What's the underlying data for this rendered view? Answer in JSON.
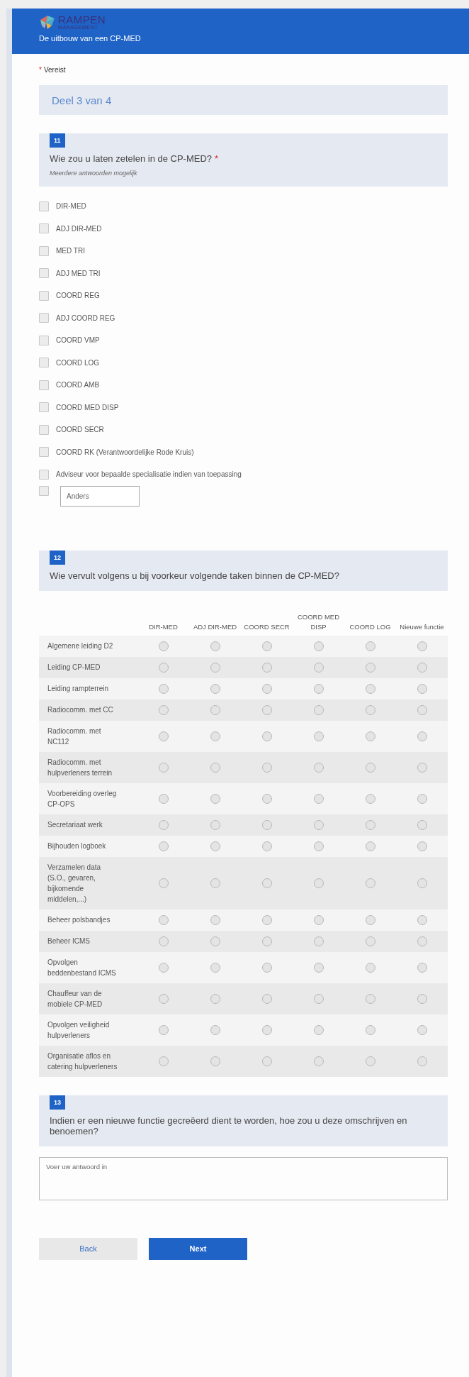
{
  "header": {
    "logo_name": "RAMPEN",
    "logo_tagline": "MANAGEMENT",
    "title": "De uitbouw van een CP-MED"
  },
  "required_note": {
    "mark": "*",
    "text": "Vereist"
  },
  "section": "Deel 3 van 4",
  "questions": [
    {
      "kind": "checkboxes",
      "number": "11",
      "title": "Wie zou u laten zetelen in de CP-MED?",
      "required": true,
      "hint": "Meerdere antwoorden mogelijk",
      "options": [
        {
          "label": "DIR-MED",
          "checked": false
        },
        {
          "label": "ADJ DIR-MED",
          "checked": false
        },
        {
          "label": "MED TRI",
          "checked": false
        },
        {
          "label": "ADJ MED TRI",
          "checked": false
        },
        {
          "label": "COORD REG",
          "checked": false
        },
        {
          "label": "ADJ COORD REG",
          "checked": false
        },
        {
          "label": "COORD VMP",
          "checked": false
        },
        {
          "label": "COORD LOG",
          "checked": false
        },
        {
          "label": "COORD AMB",
          "checked": false
        },
        {
          "label": "COORD MED DISP",
          "checked": false
        },
        {
          "label": "COORD SECR",
          "checked": false
        },
        {
          "label": "COORD RK (Verantwoordelijke Rode Kruis)",
          "checked": false
        },
        {
          "label": "Adviseur voor bepaalde specialisatie indien van toepassing",
          "checked": false
        }
      ],
      "other": {
        "checked": false,
        "placeholder": "Anders"
      }
    },
    {
      "kind": "matrix",
      "number": "12",
      "title": "Wie vervult volgens u bij voorkeur volgende taken binnen de CP-MED?",
      "required": false,
      "columns": [
        "DIR-MED",
        "ADJ DIR-MED",
        "COORD SECR",
        "COORD MED DISP",
        "COORD LOG",
        "Nieuwe functie"
      ],
      "rows": [
        {
          "label": "Algemene leiding D2",
          "cells": [
            {
              "selected": false
            },
            {
              "selected": false
            },
            {
              "selected": false
            },
            {
              "selected": false
            },
            {
              "selected": false
            },
            {
              "selected": false
            }
          ]
        },
        {
          "label": "Leiding CP-MED",
          "cells": [
            {
              "selected": false
            },
            {
              "selected": false
            },
            {
              "selected": false
            },
            {
              "selected": false
            },
            {
              "selected": false
            },
            {
              "selected": false
            }
          ]
        },
        {
          "label": "Leiding rampterrein",
          "cells": [
            {
              "selected": false
            },
            {
              "selected": false
            },
            {
              "selected": false
            },
            {
              "selected": false
            },
            {
              "selected": false
            },
            {
              "selected": false
            }
          ]
        },
        {
          "label": "Radiocomm. met CC",
          "cells": [
            {
              "selected": false
            },
            {
              "selected": false
            },
            {
              "selected": false
            },
            {
              "selected": false
            },
            {
              "selected": false
            },
            {
              "selected": false
            }
          ]
        },
        {
          "label": "Radiocomm. met NC112",
          "cells": [
            {
              "selected": false
            },
            {
              "selected": false
            },
            {
              "selected": false
            },
            {
              "selected": false
            },
            {
              "selected": false
            },
            {
              "selected": false
            }
          ]
        },
        {
          "label": "Radiocomm. met hulpverleners terrein",
          "cells": [
            {
              "selected": false
            },
            {
              "selected": false
            },
            {
              "selected": false
            },
            {
              "selected": false
            },
            {
              "selected": false
            },
            {
              "selected": false
            }
          ]
        },
        {
          "label": "Voorbereiding overleg CP-OPS",
          "cells": [
            {
              "selected": false
            },
            {
              "selected": false
            },
            {
              "selected": false
            },
            {
              "selected": false
            },
            {
              "selected": false
            },
            {
              "selected": false
            }
          ]
        },
        {
          "label": "Secretariaat werk",
          "cells": [
            {
              "selected": false
            },
            {
              "selected": false
            },
            {
              "selected": false
            },
            {
              "selected": false
            },
            {
              "selected": false
            },
            {
              "selected": false
            }
          ]
        },
        {
          "label": "Bijhouden logboek",
          "cells": [
            {
              "selected": false
            },
            {
              "selected": false
            },
            {
              "selected": false
            },
            {
              "selected": false
            },
            {
              "selected": false
            },
            {
              "selected": false
            }
          ]
        },
        {
          "label": "Verzamelen data (S.O., gevaren, bijkomende middelen,...)",
          "cells": [
            {
              "selected": false
            },
            {
              "selected": false
            },
            {
              "selected": false
            },
            {
              "selected": false
            },
            {
              "selected": false
            },
            {
              "selected": false
            }
          ]
        },
        {
          "label": "Beheer polsbandjes",
          "cells": [
            {
              "selected": false
            },
            {
              "selected": false
            },
            {
              "selected": false
            },
            {
              "selected": false
            },
            {
              "selected": false
            },
            {
              "selected": false
            }
          ]
        },
        {
          "label": "Beheer ICMS",
          "cells": [
            {
              "selected": false
            },
            {
              "selected": false
            },
            {
              "selected": false
            },
            {
              "selected": false
            },
            {
              "selected": false
            },
            {
              "selected": false
            }
          ]
        },
        {
          "label": "Opvolgen beddenbestand ICMS",
          "cells": [
            {
              "selected": false
            },
            {
              "selected": false
            },
            {
              "selected": false
            },
            {
              "selected": false
            },
            {
              "selected": false
            },
            {
              "selected": false
            }
          ]
        },
        {
          "label": "Chauffeur van de mobiele CP-MED",
          "cells": [
            {
              "selected": false
            },
            {
              "selected": false
            },
            {
              "selected": false
            },
            {
              "selected": false
            },
            {
              "selected": false
            },
            {
              "selected": false
            }
          ]
        },
        {
          "label": "Opvolgen veiligheid hulpverleners",
          "cells": [
            {
              "selected": false
            },
            {
              "selected": false
            },
            {
              "selected": false
            },
            {
              "selected": false
            },
            {
              "selected": false
            },
            {
              "selected": false
            }
          ]
        },
        {
          "label": "Organisatie aflos en catering hulpverleners",
          "cells": [
            {
              "selected": false
            },
            {
              "selected": false
            },
            {
              "selected": false
            },
            {
              "selected": false
            },
            {
              "selected": false
            },
            {
              "selected": false
            }
          ]
        }
      ]
    },
    {
      "kind": "text",
      "number": "13",
      "title": "Indien er een nieuwe functie gecreëerd dient te worden, hoe zou u deze omschrijven en benoemen?",
      "required": false,
      "placeholder": "Voer uw antwoord in"
    }
  ],
  "buttons": {
    "back": "Back",
    "next": "Next"
  }
}
